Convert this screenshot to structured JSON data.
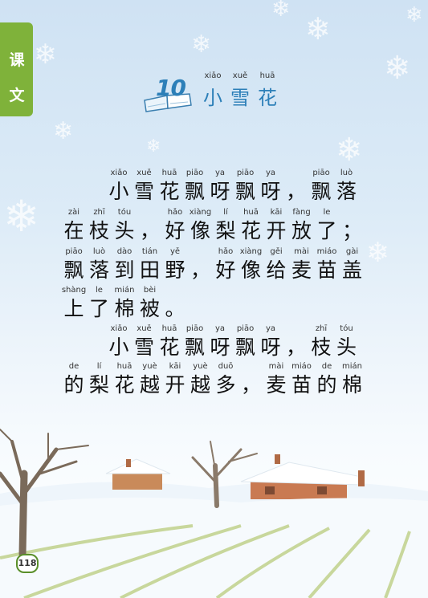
{
  "section_tab": [
    "课",
    "文"
  ],
  "lesson": {
    "number": "10",
    "title": [
      {
        "py": "xiǎo",
        "hz": "小"
      },
      {
        "py": "xuě",
        "hz": "雪"
      },
      {
        "py": "huā",
        "hz": "花"
      }
    ]
  },
  "lines": [
    [
      {
        "py": "xiǎo",
        "hz": "小"
      },
      {
        "py": "xuě",
        "hz": "雪"
      },
      {
        "py": "huā",
        "hz": "花"
      },
      {
        "py": "piāo",
        "hz": "飘"
      },
      {
        "py": "ya",
        "hz": "呀"
      },
      {
        "py": "piāo",
        "hz": "飘"
      },
      {
        "py": "ya",
        "hz": "呀"
      },
      {
        "py": "",
        "hz": "，"
      },
      {
        "py": "piāo",
        "hz": "飘"
      },
      {
        "py": "luò",
        "hz": "落"
      }
    ],
    [
      {
        "py": "zài",
        "hz": "在"
      },
      {
        "py": "zhī",
        "hz": "枝"
      },
      {
        "py": "tóu",
        "hz": "头"
      },
      {
        "py": "",
        "hz": "，"
      },
      {
        "py": "hǎo",
        "hz": "好"
      },
      {
        "py": "xiàng",
        "hz": "像"
      },
      {
        "py": "lí",
        "hz": "梨"
      },
      {
        "py": "huā",
        "hz": "花"
      },
      {
        "py": "kāi",
        "hz": "开"
      },
      {
        "py": "fàng",
        "hz": "放"
      },
      {
        "py": "le",
        "hz": "了"
      },
      {
        "py": "",
        "hz": "；"
      }
    ],
    [
      {
        "py": "piāo",
        "hz": "飘"
      },
      {
        "py": "luò",
        "hz": "落"
      },
      {
        "py": "dào",
        "hz": "到"
      },
      {
        "py": "tián",
        "hz": "田"
      },
      {
        "py": "yě",
        "hz": "野"
      },
      {
        "py": "",
        "hz": "，"
      },
      {
        "py": "hǎo",
        "hz": "好"
      },
      {
        "py": "xiàng",
        "hz": "像"
      },
      {
        "py": "gěi",
        "hz": "给"
      },
      {
        "py": "mài",
        "hz": "麦"
      },
      {
        "py": "miáo",
        "hz": "苗"
      },
      {
        "py": "gài",
        "hz": "盖"
      }
    ],
    [
      {
        "py": "shàng",
        "hz": "上"
      },
      {
        "py": "le",
        "hz": "了"
      },
      {
        "py": "mián",
        "hz": "棉"
      },
      {
        "py": "bèi",
        "hz": "被"
      },
      {
        "py": "",
        "hz": "。"
      }
    ],
    [
      {
        "py": "xiǎo",
        "hz": "小"
      },
      {
        "py": "xuě",
        "hz": "雪"
      },
      {
        "py": "huā",
        "hz": "花"
      },
      {
        "py": "piāo",
        "hz": "飘"
      },
      {
        "py": "ya",
        "hz": "呀"
      },
      {
        "py": "piāo",
        "hz": "飘"
      },
      {
        "py": "ya",
        "hz": "呀"
      },
      {
        "py": "",
        "hz": "，"
      },
      {
        "py": "zhī",
        "hz": "枝"
      },
      {
        "py": "tóu",
        "hz": "头"
      }
    ],
    [
      {
        "py": "de",
        "hz": "的"
      },
      {
        "py": "lí",
        "hz": "梨"
      },
      {
        "py": "huā",
        "hz": "花"
      },
      {
        "py": "yuè",
        "hz": "越"
      },
      {
        "py": "kāi",
        "hz": "开"
      },
      {
        "py": "yuè",
        "hz": "越"
      },
      {
        "py": "duō",
        "hz": "多"
      },
      {
        "py": "",
        "hz": "，"
      },
      {
        "py": "mài",
        "hz": "麦"
      },
      {
        "py": "miáo",
        "hz": "苗"
      },
      {
        "py": "de",
        "hz": "的"
      },
      {
        "py": "mián",
        "hz": "棉"
      }
    ]
  ],
  "page_number": "118",
  "colors": {
    "tab": "#7fb23a",
    "title": "#2c7fb8",
    "text": "#111111"
  }
}
